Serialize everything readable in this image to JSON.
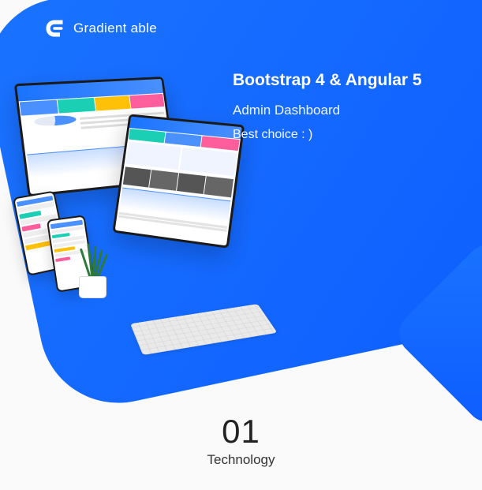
{
  "brand": {
    "name": "Gradient able"
  },
  "hero": {
    "title": "Bootstrap 4 & Angular 5",
    "subtitle": "Admin Dashboard",
    "tagline": "Best choice : )"
  },
  "section": {
    "number": "01",
    "label": "Technology"
  },
  "colors": {
    "primary": "#1a73ff",
    "primaryDark": "#0d5dff"
  }
}
